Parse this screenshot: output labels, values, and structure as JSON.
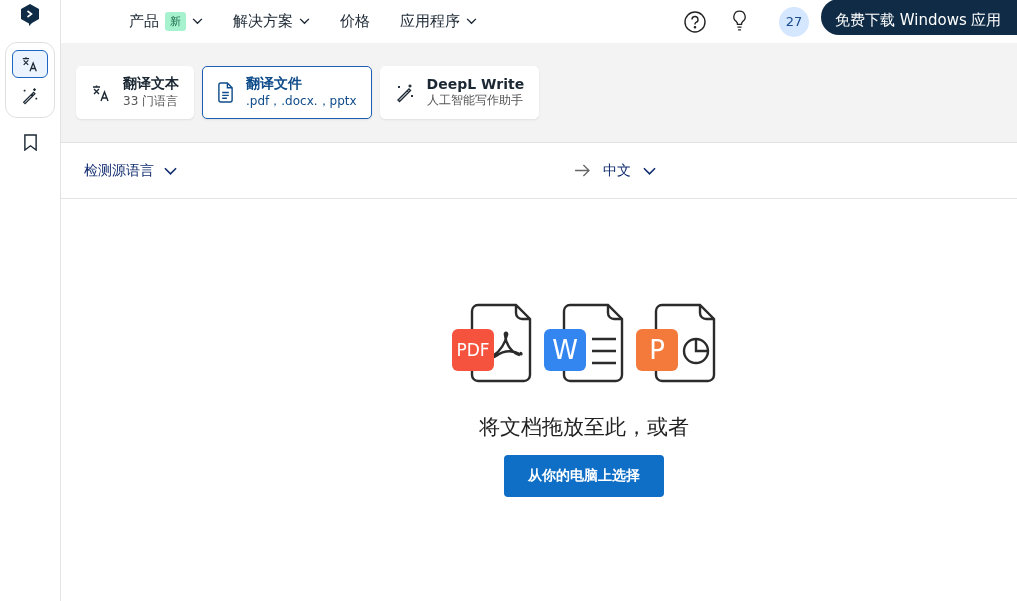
{
  "nav": {
    "items": [
      {
        "label": "产品",
        "badge": "新",
        "has_caret": true
      },
      {
        "label": "解决方案",
        "has_caret": true
      },
      {
        "label": "价格",
        "has_caret": false
      },
      {
        "label": "应用程序",
        "has_caret": true
      }
    ],
    "notification_count": "27",
    "download_button": "免费下载 Windows 应用"
  },
  "sidebar": {
    "items": [
      {
        "kind": "translate",
        "selected": true
      },
      {
        "kind": "write",
        "selected": false
      }
    ]
  },
  "tabs": [
    {
      "kind": "text",
      "title": "翻译文本",
      "subtitle": "33 门语言",
      "selected": false
    },
    {
      "kind": "file",
      "title": "翻译文件",
      "subtitle": ".pdf，.docx.，pptx",
      "selected": true
    },
    {
      "kind": "write",
      "title": "DeepL Write",
      "subtitle": "人工智能写作助手",
      "selected": false
    }
  ],
  "language_bar": {
    "source": "检测源语言",
    "target": "中文"
  },
  "drop_area": {
    "file_types": [
      {
        "kind": "pdf",
        "label": "PDF",
        "color": "#f5533d"
      },
      {
        "kind": "word",
        "label": "W",
        "color": "#3385f0"
      },
      {
        "kind": "ppt",
        "label": "P",
        "color": "#f47a3c"
      }
    ],
    "prompt": "将文档拖放至此，或者",
    "button": "从你的电脑上选择"
  }
}
